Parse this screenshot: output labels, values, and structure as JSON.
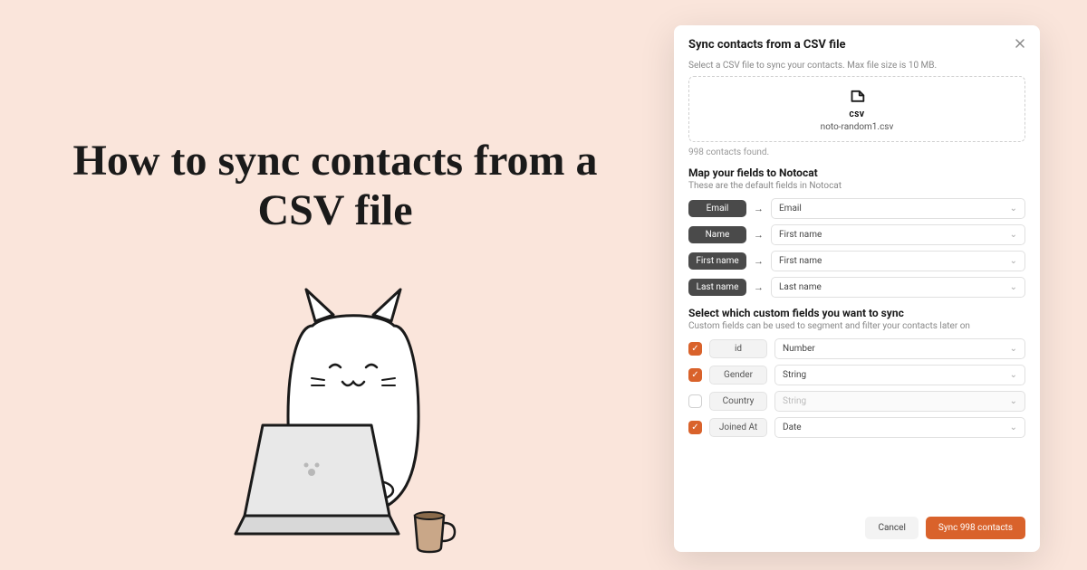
{
  "hero": {
    "title": "How to sync contacts from a CSV file"
  },
  "modal": {
    "title": "Sync contacts from a CSV file",
    "help": "Select a CSV file to sync your contacts. Max file size is 10 MB.",
    "csv_badge": "CSV",
    "filename": "noto-random1.csv",
    "found": "998 contacts found.",
    "map_title": "Map your fields to Notocat",
    "map_sub": "These are the default fields in Notocat",
    "map_rows": [
      {
        "source": "Email",
        "target": "Email"
      },
      {
        "source": "Name",
        "target": "First name"
      },
      {
        "source": "First name",
        "target": "First name"
      },
      {
        "source": "Last name",
        "target": "Last name"
      }
    ],
    "custom_title": "Select which custom fields you want to sync",
    "custom_sub": "Custom fields can be used to segment and filter your contacts later on",
    "custom_rows": [
      {
        "checked": true,
        "field": "id",
        "type": "Number"
      },
      {
        "checked": true,
        "field": "Gender",
        "type": "String"
      },
      {
        "checked": false,
        "field": "Country",
        "type": "String"
      },
      {
        "checked": true,
        "field": "Joined At",
        "type": "Date"
      }
    ],
    "cancel": "Cancel",
    "submit": "Sync 998 contacts"
  }
}
